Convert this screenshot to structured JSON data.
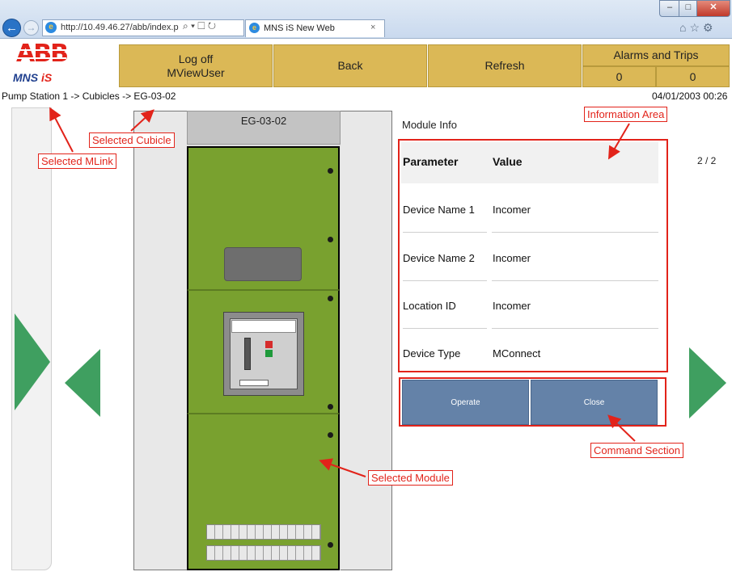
{
  "browser": {
    "url": "http://10.49.46.27/abb/index.p",
    "tab_title": "MNS iS New Web",
    "tab_close": "×",
    "back_glyph": "←",
    "forward_glyph": "→",
    "addr_tools": "⌕ ▾ ☐ ↻",
    "right_icons": "⌂☆⚙",
    "win_min": "–",
    "win_max": "□",
    "win_close": "✕"
  },
  "logo": {
    "brand": "ABB",
    "product": "MNS",
    "product_suffix": "iS"
  },
  "header": {
    "logoff_line1": "Log off",
    "logoff_line2": "MViewUser",
    "back": "Back",
    "refresh": "Refresh",
    "alarms_title": "Alarms and Trips",
    "alarms_count": "0",
    "trips_count": "0"
  },
  "breadcrumb": "Pump Station 1 -> Cubicles -> EG-03-02",
  "datetime": "04/01/2003 00:26",
  "cubicle": {
    "title": "EG-03-02"
  },
  "module_info": {
    "title": "Module Info",
    "page": "2 / 2",
    "headers": {
      "parameter": "Parameter",
      "value": "Value"
    },
    "rows": [
      {
        "parameter": "Device Name 1",
        "value": "Incomer"
      },
      {
        "parameter": "Device Name 2",
        "value": "Incomer"
      },
      {
        "parameter": "Location ID",
        "value": "Incomer"
      },
      {
        "parameter": "Device Type",
        "value": "MConnect"
      }
    ]
  },
  "commands": {
    "operate": "Operate",
    "close": "Close"
  },
  "annotations": {
    "selected_mlink": "Selected MLink",
    "selected_cubicle": "Selected Cubicle",
    "information_area": "Information Area",
    "selected_module": "Selected Module",
    "command_section": "Command Section"
  },
  "colors": {
    "header_button": "#dbb856",
    "command_button": "#6482a8",
    "nav_arrow": "#3f9f60",
    "module_green": "#79a12f",
    "annotation_red": "#e2231a",
    "abb_red": "#e2231a"
  }
}
